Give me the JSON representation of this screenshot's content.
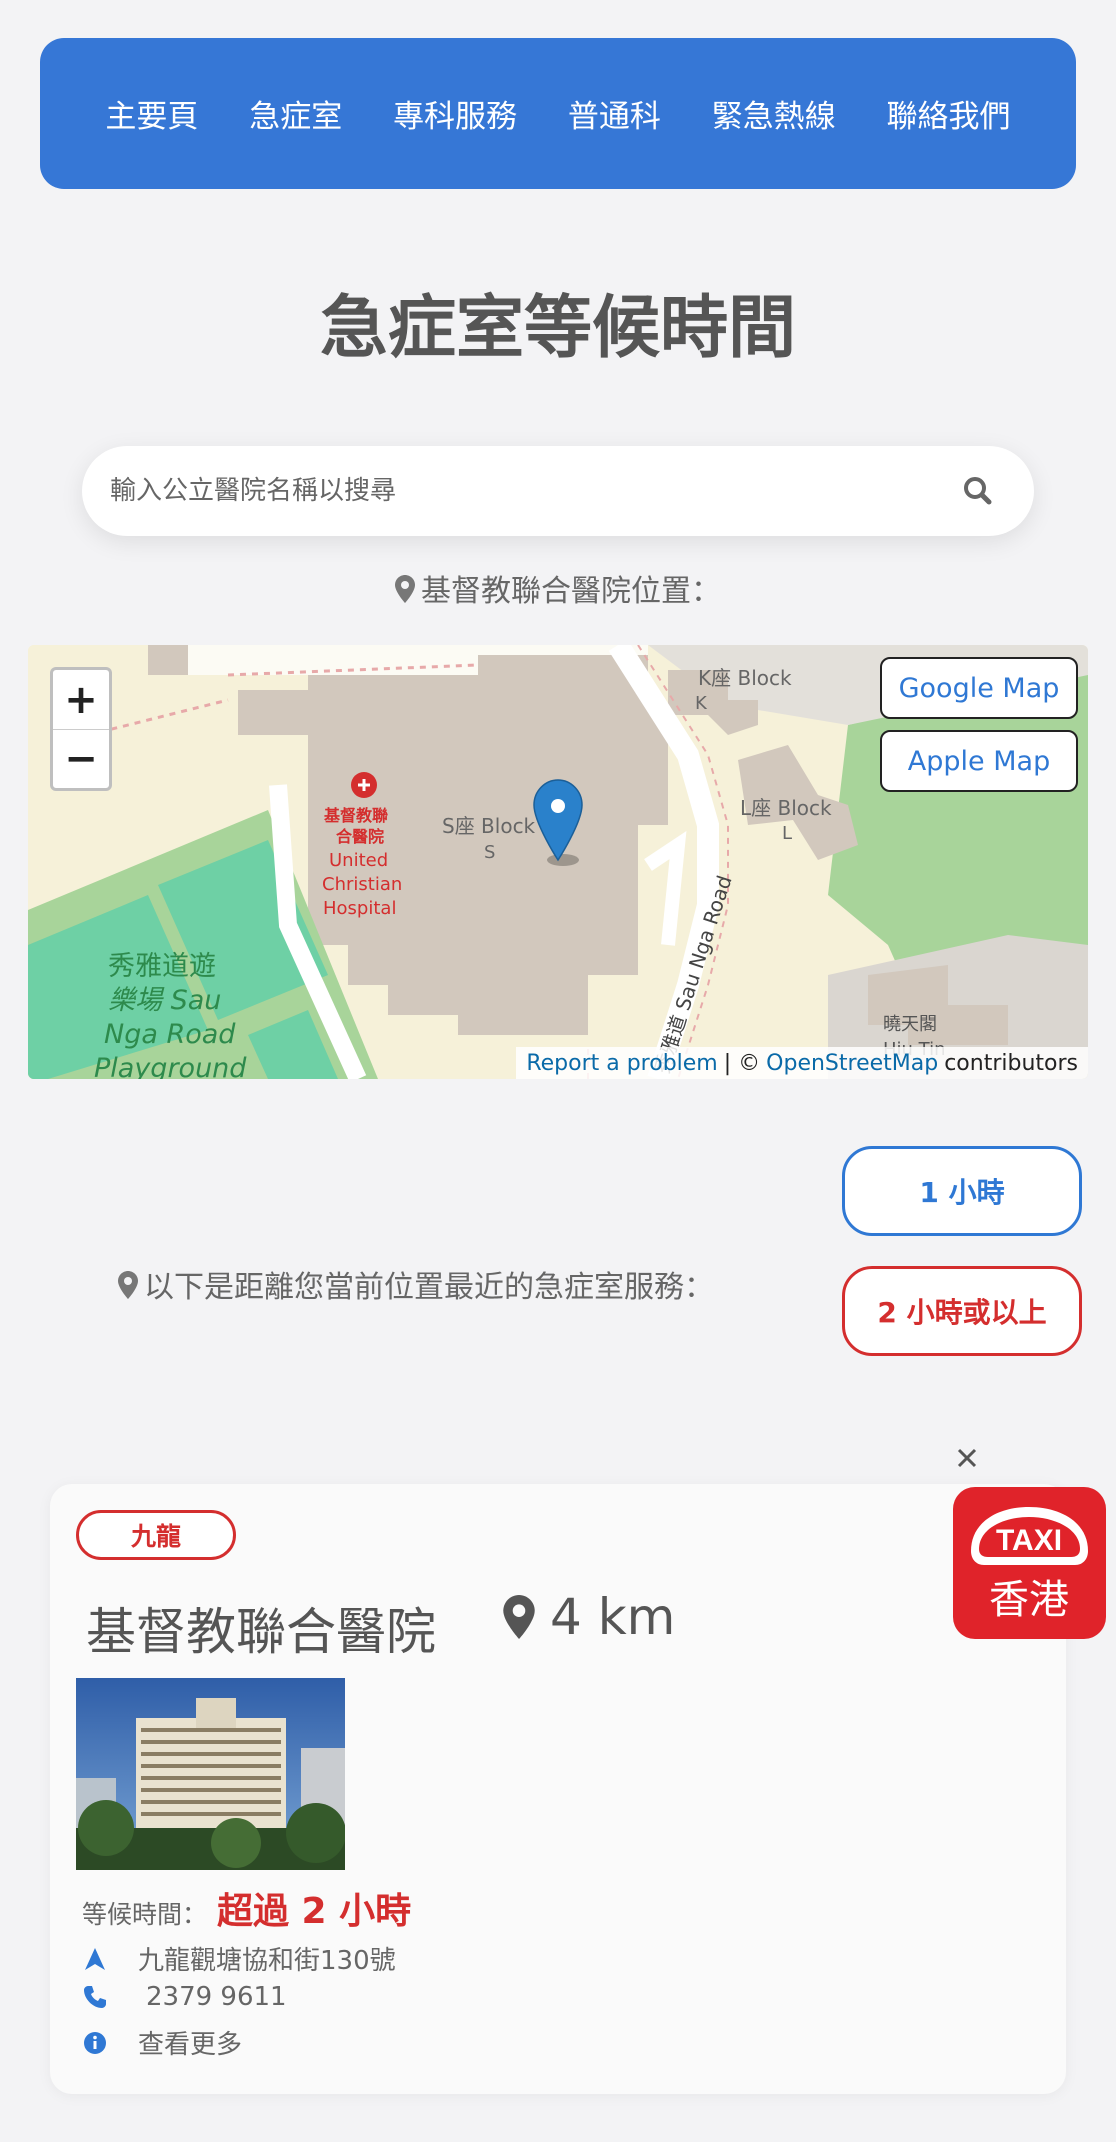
{
  "nav": {
    "items": [
      {
        "label": "主要頁"
      },
      {
        "label": "急症室"
      },
      {
        "label": "專科服務"
      },
      {
        "label": "普通科"
      },
      {
        "label": "緊急熱線"
      },
      {
        "label": "聯絡我們"
      }
    ]
  },
  "page": {
    "title": "急症室等候時間"
  },
  "search": {
    "placeholder": "輸入公立醫院名稱以搜尋"
  },
  "location_label": "基督教聯合醫院位置：",
  "map": {
    "zoom_in": "+",
    "zoom_out": "−",
    "google_map": "Google Map",
    "apple_map": "Apple Map",
    "report_problem": "Report a problem",
    "attribution_sep": "| ©",
    "osm": "OpenStreetMap",
    "contributors": "contributors",
    "labels": {
      "k_block": "K座 Block",
      "k": "K",
      "s_block": "S座 Block",
      "s": "S",
      "l_block": "L座 Block",
      "l": "L",
      "hospital_zh1": "基督教聯",
      "hospital_zh2": "合醫院",
      "hospital_en1": "United",
      "hospital_en2": "Christian",
      "hospital_en3": "Hospital",
      "playground1": "秀雅道遊",
      "playground2": "樂場 Sau",
      "playground3": "Nga Road",
      "playground4": "Playground",
      "road": "秀雅道 Sau Nga Road",
      "hiu_tin1": "曉天閣",
      "hiu_tin2": "Hiu Tin"
    }
  },
  "filters": {
    "one_hour": "1 小時",
    "two_hours": "2 小時或以上",
    "blue": "#2f78d4",
    "red": "#d42e2e"
  },
  "nearest_label": "以下是距離您當前位置最近的急症室服務：",
  "card": {
    "region": "九龍",
    "name": "基督教聯合醫院",
    "distance": "4 km",
    "wait_label": "等候時間：",
    "wait_value": "超過 2 小時",
    "address": "九龍觀塘協和街130號",
    "phone": "2379 9611",
    "more": "查看更多"
  },
  "taxi": {
    "top": "TAXI",
    "bottom": "香港"
  },
  "colors": {
    "nav": "#3677d6",
    "accent_red": "#d42e2e"
  }
}
